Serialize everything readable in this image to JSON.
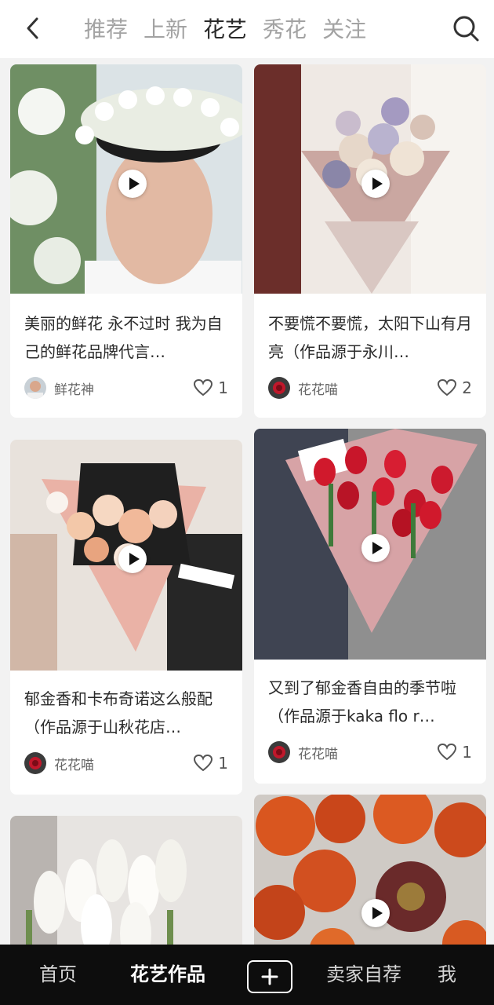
{
  "header": {
    "back_icon": "chevron-left-icon",
    "tabs": [
      {
        "label": "推荐",
        "active": false
      },
      {
        "label": "上新",
        "active": false
      },
      {
        "label": "花艺",
        "active": true
      },
      {
        "label": "秀花",
        "active": false
      },
      {
        "label": "关注",
        "active": false
      }
    ],
    "search_icon": "search-icon"
  },
  "feed": {
    "cards": [
      {
        "title": "美丽的鲜花 永不过时 我为自己的鲜花品牌代言…",
        "author": "鲜花神",
        "likes": "1",
        "is_video": true
      },
      {
        "title": "不要慌不要慌，太阳下山有月亮（作品源于永川…",
        "author": "花花喵",
        "likes": "2",
        "is_video": true
      },
      {
        "title": "郁金香和卡布奇诺这么般配（作品源于山秋花店…",
        "author": "花花喵",
        "likes": "1",
        "is_video": true
      },
      {
        "title": "又到了郁金香自由的季节啦（作品源于kaka flo r…",
        "author": "花花喵",
        "likes": "1",
        "is_video": true
      },
      {
        "title": "",
        "author": "",
        "likes": "",
        "is_video": false
      },
      {
        "title": "",
        "author": "",
        "likes": "",
        "is_video": true
      }
    ]
  },
  "bottom_nav": {
    "items": [
      {
        "label": "首页",
        "active": false
      },
      {
        "label": "花艺作品",
        "active": true
      },
      {
        "label": "卖家自荐",
        "active": false
      },
      {
        "label": "我",
        "active": false
      }
    ],
    "add_label": "+"
  },
  "colors": {
    "active_tab": "#2a2a2a",
    "inactive_tab": "#a3a3a3",
    "nav_background": "#0d0d0d",
    "page_background": "#f2f2f2"
  }
}
